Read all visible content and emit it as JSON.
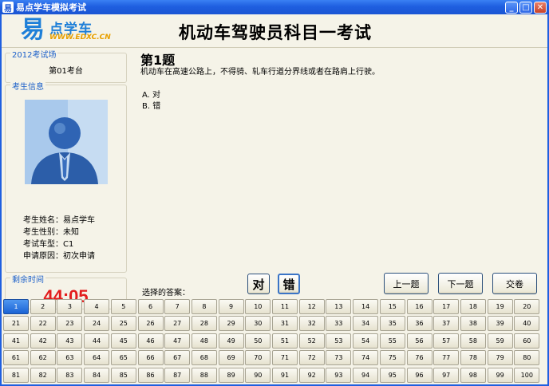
{
  "window": {
    "title": "易点学车模拟考试",
    "app_icon": "易",
    "minimize_glyph": "_",
    "maximize_glyph": "□",
    "close_glyph": "✕"
  },
  "logo": {
    "big_char": "易",
    "name": "点学车",
    "url": "WWW.EDXC.CN"
  },
  "header": {
    "title": "机动车驾驶员科目一考试"
  },
  "venue": {
    "legend": "2012考试场",
    "seat": "第01考台"
  },
  "examinee": {
    "legend": "考生信息",
    "rows": [
      "考生姓名：易点学车",
      "考生性别：未知",
      "考试车型：C1",
      "申请原因：初次申请"
    ]
  },
  "timer": {
    "legend": "剩余时间",
    "value": "44:05"
  },
  "question": {
    "number": "第1题",
    "text": "机动车在高速公路上，不得骑、轧车行道分界线或者在路肩上行驶。",
    "options": [
      "A. 对",
      "B. 错"
    ]
  },
  "answer": {
    "label": "选择的答案：",
    "buttons": [
      "对",
      "错"
    ],
    "selected": "错"
  },
  "nav": {
    "prev": "上一题",
    "next": "下一题",
    "submit": "交卷"
  },
  "grid": {
    "current": 1,
    "total": 100
  },
  "colors": {
    "accent": "#1e7fd8",
    "timer": "#e21d1d",
    "titlebar": "#1f5fe0"
  },
  "icons": {
    "avatar": "person-silhouette-icon"
  }
}
